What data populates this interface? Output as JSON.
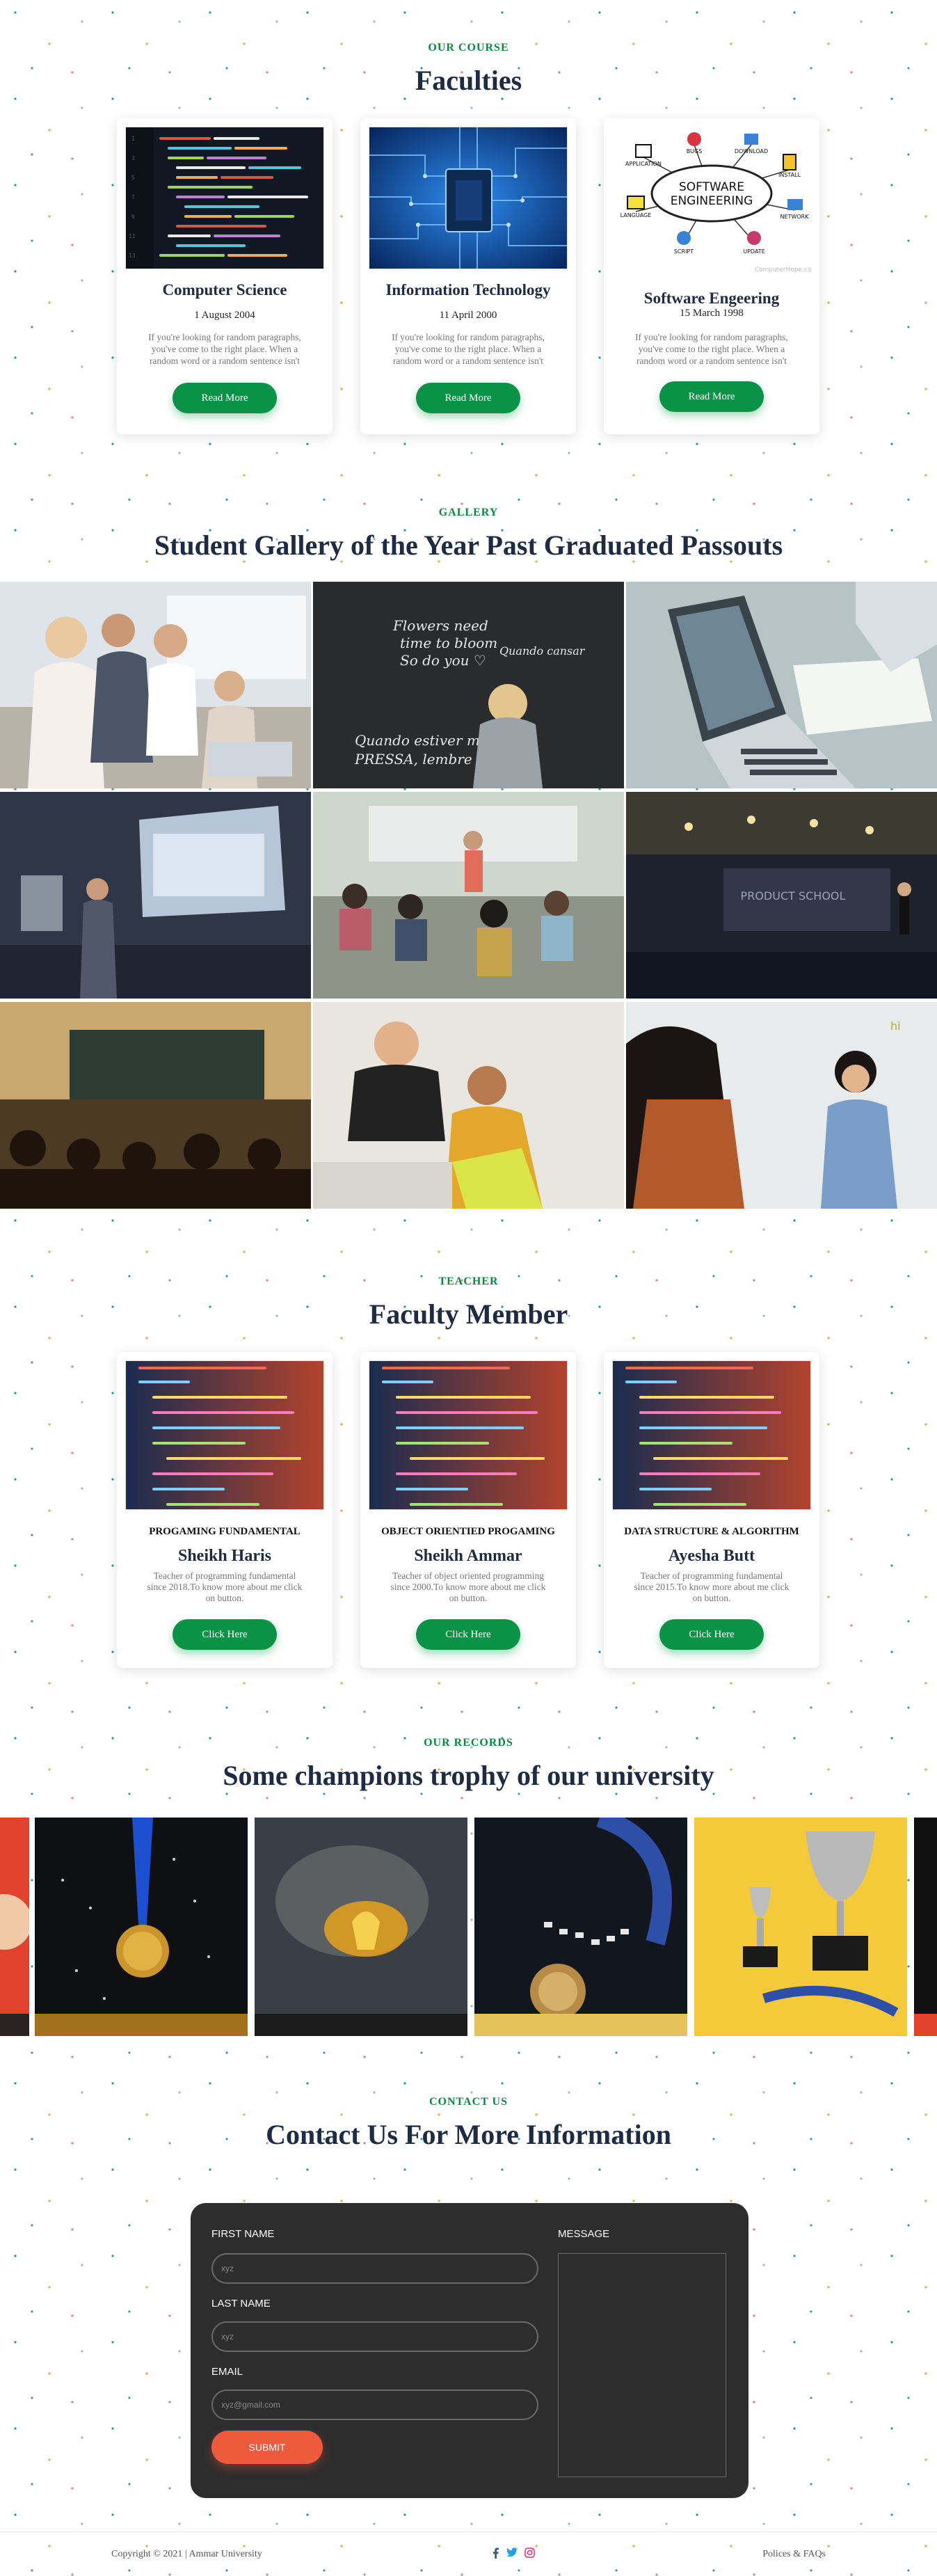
{
  "faculties": {
    "eyebrow": "OUR COURSE",
    "title": "Faculties",
    "read_more": "Read More",
    "cards": [
      {
        "name": "Computer Science",
        "date": "1 August 2004",
        "desc": "If you're looking for random paragraphs, you've come to the right place. When a random word or a random sentence isn't quite enough, t..."
      },
      {
        "name": "Information Technology",
        "date": "11 April 2000",
        "desc": "If you're looking for random paragraphs, you've come to the right place. When a random word or a random sentence isn't quite enough, t..."
      },
      {
        "name": "Software Engeering",
        "date": "15 March 1998",
        "desc": "If you're looking for random paragraphs, you've come to the right place. When a random word or a random sentence isn't quite enough, t..."
      }
    ],
    "se_diagram": {
      "center_line1": "SOFTWARE",
      "center_line2": "ENGINEERING",
      "nodes": [
        "APPLICATION",
        "BUGS",
        "DOWNLOAD",
        "INSTALL",
        "NETWORK",
        "UPDATE",
        "SCRIPT",
        "LANGUAGE"
      ],
      "watermark": "ComputerHope.com"
    }
  },
  "gallery": {
    "eyebrow": "GALLERY",
    "title": "Student Gallery of the Year Past Graduated Passouts",
    "chalk_text_1": "Flowers need time to bloom So do you ♡",
    "chalk_text_2": "Quando estiver muita pressa, lembre",
    "chalk_text_3": "Quando cansar",
    "stage_sign": "PRODUCT SCHOOL"
  },
  "teachers": {
    "eyebrow": "TEACHER",
    "title": "Faculty Member",
    "click_label": "Click Here",
    "cards": [
      {
        "subject": "PROGAMING FUNDAMENTAL",
        "name": "Sheikh Haris",
        "desc": "Teacher of programming fundamental since 2018.To know more about me click on button."
      },
      {
        "subject": "OBJECT ORIENTIED PROGAMING",
        "name": "Sheikh Ammar",
        "desc": "Teacher of object oriented programming since 2000.To know more about me click on button."
      },
      {
        "subject": "DATA STRUCTURE & ALGORITHM",
        "name": "Ayesha Butt",
        "desc": "Teacher of programming fundamental since 2015.To know more about me click on button."
      }
    ]
  },
  "records": {
    "eyebrow": "OUR RECORDS",
    "title": "Some champions trophy of our university"
  },
  "contact": {
    "eyebrow": "CONTACT US",
    "title": "Contact Us For More Information",
    "first_name_label": "FIRST NAME",
    "first_name_placeholder": "xyz",
    "last_name_label": "LAST NAME",
    "last_name_placeholder": "xyz",
    "email_label": "EMAIL",
    "email_placeholder": "xyz@gmail.com",
    "message_label": "MESSAGE",
    "submit_label": "SUBMIT"
  },
  "footer": {
    "copyright": "Copyright © 2021 | Ammar University",
    "policy": "Polices & FAQs",
    "social_icons": [
      "facebook-icon",
      "twitter-icon",
      "instagram-icon"
    ]
  },
  "colors": {
    "accent_green": "#0a9246",
    "navy": "#1f2a44",
    "submit_orange": "#ef5a3c",
    "form_bg": "#2d2d2d"
  }
}
